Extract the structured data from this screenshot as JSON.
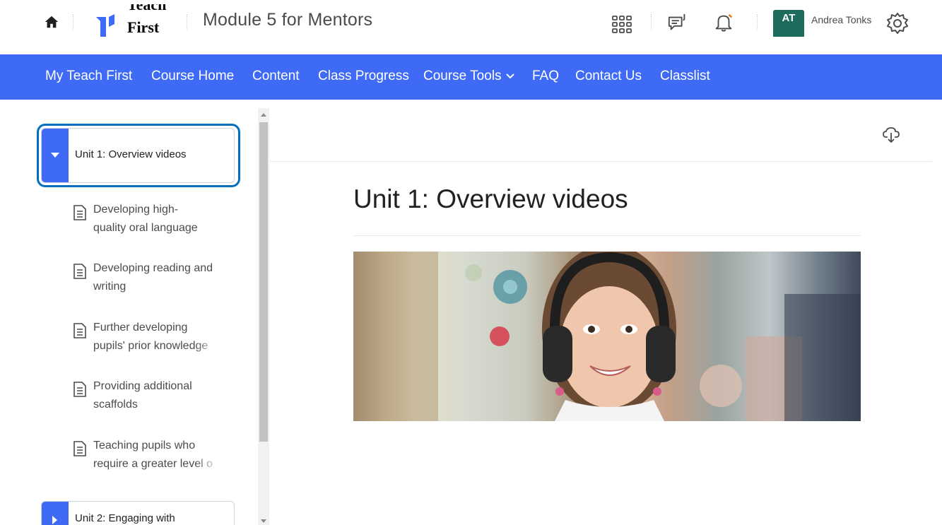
{
  "header": {
    "logo_text_line1": "Teach",
    "logo_text_line2": "First",
    "course_title": "Module 5 for Mentors",
    "user_initials": "AT",
    "user_name": "Andrea Tonks"
  },
  "nav": {
    "items": [
      {
        "label": "My Teach First"
      },
      {
        "label": "Course Home"
      },
      {
        "label": "Content"
      },
      {
        "label": "Class Progress"
      },
      {
        "label": "Course Tools"
      },
      {
        "label": "FAQ"
      },
      {
        "label": "Contact Us"
      },
      {
        "label": "Classlist"
      }
    ]
  },
  "sidebar": {
    "units": [
      {
        "label": "Unit 1: Overview videos",
        "expanded": true,
        "selected": true
      },
      {
        "label": "Unit 2: Engaging with",
        "expanded": false,
        "selected": false
      }
    ],
    "topics": [
      {
        "line1": "Developing high-",
        "line2": "quality oral language"
      },
      {
        "line1": "Developing reading and",
        "line2": "writing"
      },
      {
        "line1": "Further developing",
        "line2": "pupils' prior knowledge"
      },
      {
        "line1": "Providing additional",
        "line2": "scaffolds"
      },
      {
        "line1": "Teaching pupils who",
        "line2": "require a greater level o"
      }
    ]
  },
  "main": {
    "title": "Unit 1: Overview videos"
  },
  "colors": {
    "nav_bg": "#3e6af5",
    "avatar_bg": "#1d6b5c",
    "focus_ring": "#006fbf"
  },
  "icons": [
    "home-icon",
    "apps-grid-icon",
    "chat-icon",
    "bell-icon",
    "gear-icon",
    "caret-down-icon",
    "caret-right-icon",
    "document-icon",
    "cloud-download-icon",
    "chevron-down-icon"
  ]
}
